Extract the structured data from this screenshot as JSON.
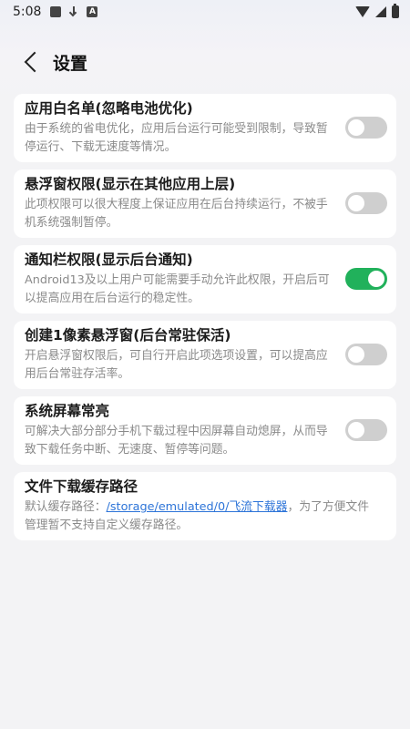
{
  "status_bar": {
    "time": "5:08",
    "icons_left": [
      "square-notification-icon",
      "download-icon",
      "a-icon"
    ],
    "icons_right": [
      "wifi-icon",
      "signal-icon",
      "battery-icon"
    ]
  },
  "header": {
    "back_icon": "chevron-left-icon",
    "title": "设置"
  },
  "settings": [
    {
      "title": "应用白名单(忽略电池优化)",
      "desc": "由于系统的省电优化，应用后台运行可能受到限制，导致暂停运行、下载无速度等情况。",
      "enabled": false
    },
    {
      "title": "悬浮窗权限(显示在其他应用上层)",
      "desc": "此项权限可以很大程度上保证应用在后台持续运行，不被手机系统强制暂停。",
      "enabled": false
    },
    {
      "title": "通知栏权限(显示后台通知)",
      "desc": "Android13及以上用户可能需要手动允许此权限，开启后可以提高应用在后台运行的稳定性。",
      "enabled": true
    },
    {
      "title": "创建1像素悬浮窗(后台常驻保活)",
      "desc": "开启悬浮窗权限后，可自行开启此项选项设置，可以提高应用后台常驻存活率。",
      "enabled": false
    },
    {
      "title": "系统屏幕常亮",
      "desc": "可解决大部分部分手机下载过程中因屏幕自动熄屏，从而导致下载任务中断、无速度、暂停等问题。",
      "enabled": false
    }
  ],
  "download_path": {
    "title": "文件下载缓存路径",
    "desc_prefix": "默认缓存路径：",
    "path": "/storage/emulated/0/飞流下载器",
    "desc_suffix": "，为了方便文件管理暂不支持自定义缓存路径。"
  },
  "colors": {
    "switch_on": "#21b15b",
    "switch_off": "#cfcfcf",
    "link": "#2d74d8"
  }
}
